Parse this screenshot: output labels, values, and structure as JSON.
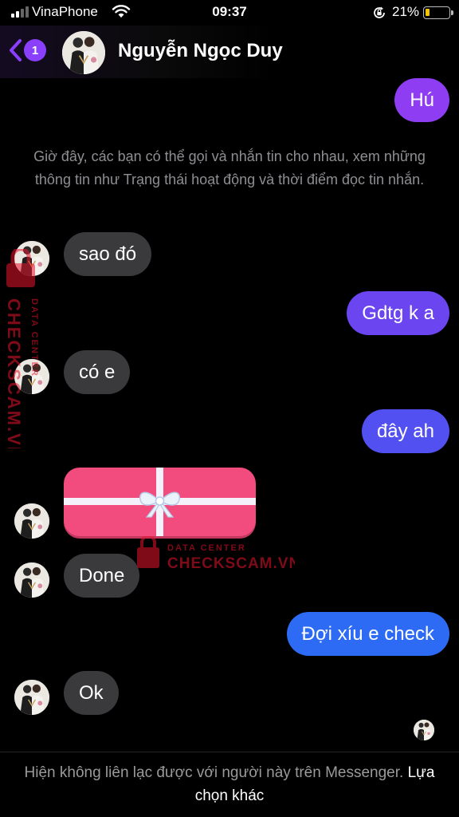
{
  "status_bar": {
    "carrier": "VinaPhone",
    "time": "09:37",
    "battery_percent": "21%",
    "battery_level": 0.21,
    "icons": [
      "signal-icon",
      "wifi-icon",
      "rotation-lock-icon",
      "battery-icon"
    ]
  },
  "header": {
    "back_icon": "chevron-left-icon",
    "unread_count": "1",
    "contact_name": "Nguyễn Ngọc Duy"
  },
  "messages": {
    "out_1": "Hú",
    "system_note": "Giờ đây, các bạn có thể gọi và nhắn tin cho nhau, xem những thông tin như Trạng thái hoạt động và thời điểm đọc tin nhắn.",
    "in_1": "sao đó",
    "out_2": "Gdtg k a",
    "in_2": "có e",
    "out_3": "đây ah",
    "in_gift": "gift-sticker",
    "in_3": "Done",
    "out_4": "Đợi xíu e check",
    "in_4": "Ok"
  },
  "watermark": {
    "line1": "DATA CENTER",
    "line2": "CHECKSCAM.VN"
  },
  "footer": {
    "notice": "Hiện không liên lạc được với người này trên Messenger.",
    "link": "Lựa chọn khác"
  },
  "colors": {
    "background": "#000000",
    "bubble_incoming": "#3a3a3c",
    "bubble_out_1": "#8e3df2",
    "bubble_out_2": "#6a45f0",
    "bubble_out_3": "#5350f2",
    "bubble_out_4": "#2e6bf4",
    "accent": "#8a3ffc",
    "gift": "#f24c7e"
  }
}
